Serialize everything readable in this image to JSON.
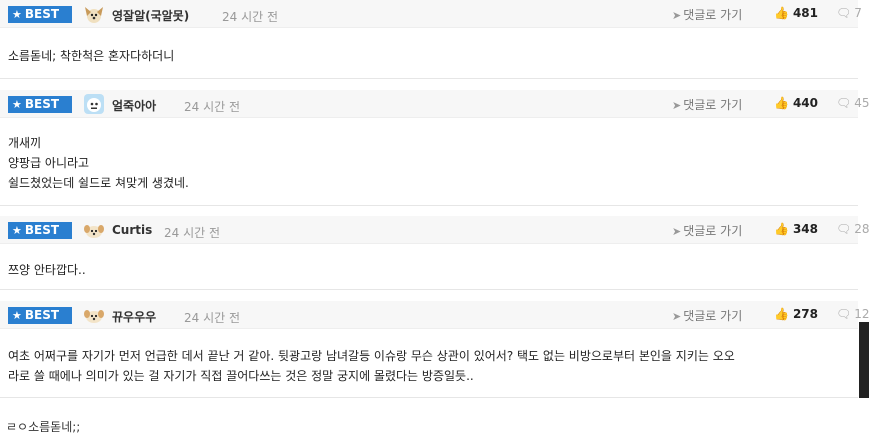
{
  "best_label": "BEST",
  "goto_label": "댓글로 가기",
  "comments": [
    {
      "author": "영잘알(국알못)",
      "time": "24 시간 전",
      "likes": "481",
      "replies": "7",
      "lines": [
        "소름돋네; 착한척은 혼자다하더니"
      ]
    },
    {
      "author": "얼죽아아",
      "time": "24 시간 전",
      "likes": "440",
      "replies": "45",
      "lines": [
        "개새끼",
        "양팡급 아니라고",
        "쉴드쳤었는데 쉴드로 쳐맞게 생겼네."
      ]
    },
    {
      "author": "Curtis",
      "time": "24 시간 전",
      "likes": "348",
      "replies": "28",
      "lines": [
        "쯔양 안타깝다.."
      ]
    },
    {
      "author": "뀨우우우",
      "time": "24 시간 전",
      "likes": "278",
      "replies": "12",
      "lines": [
        "여초 어쩌구를 자기가 먼저 언급한 데서 끝난 거 같아. 뒷광고랑 남녀갈등 이슈랑 무슨 상관이 있어서? 택도 없는 비방으로부터 본인을 지키는 오오",
        "라로 쓸 때에나 의미가 있는 걸 자기가 직접 끌어다쓰는 것은 정말 궁지에 몰렸다는 방증일듯.."
      ]
    }
  ],
  "footer_text": "ㄹㅇ소름돋네;;"
}
